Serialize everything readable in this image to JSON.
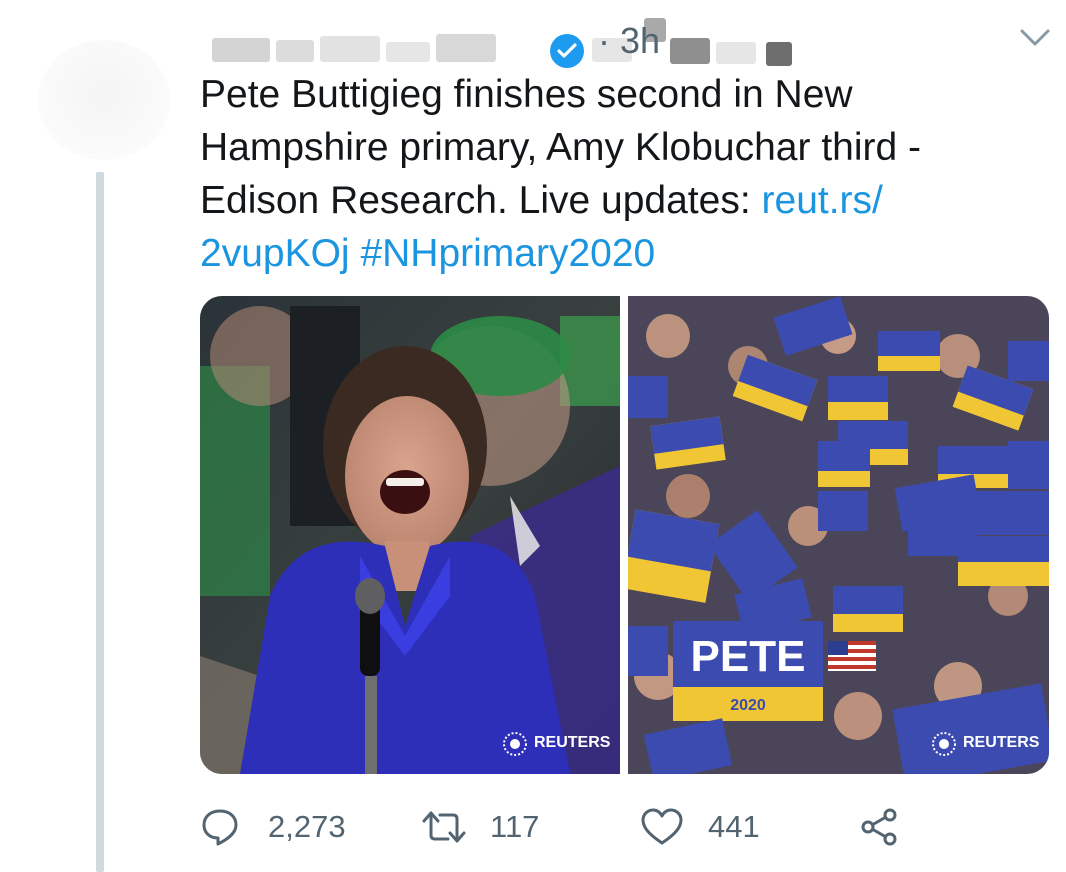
{
  "tweet": {
    "time": "· 3h",
    "text": {
      "line1": "Pete Buttigieg finishes second in New",
      "line2": "Hampshire primary, Amy Klobuchar third -",
      "line3_prefix": "Edison Research. Live updates: ",
      "link_part1": "reut.rs/",
      "link_part2": "2vupKOj",
      "hashtag": "#NHprimary2020"
    }
  },
  "media": {
    "left": {
      "watermark": "REUTERS"
    },
    "right": {
      "watermark": "REUTERS",
      "sign_big_name": "PETE",
      "sign_big_year": "2020"
    }
  },
  "actions": {
    "replies": "2,273",
    "retweets": "117",
    "likes": "441"
  },
  "colors": {
    "link": "#1b95e0",
    "verified": "#1d9bf0",
    "muted": "#536471"
  }
}
